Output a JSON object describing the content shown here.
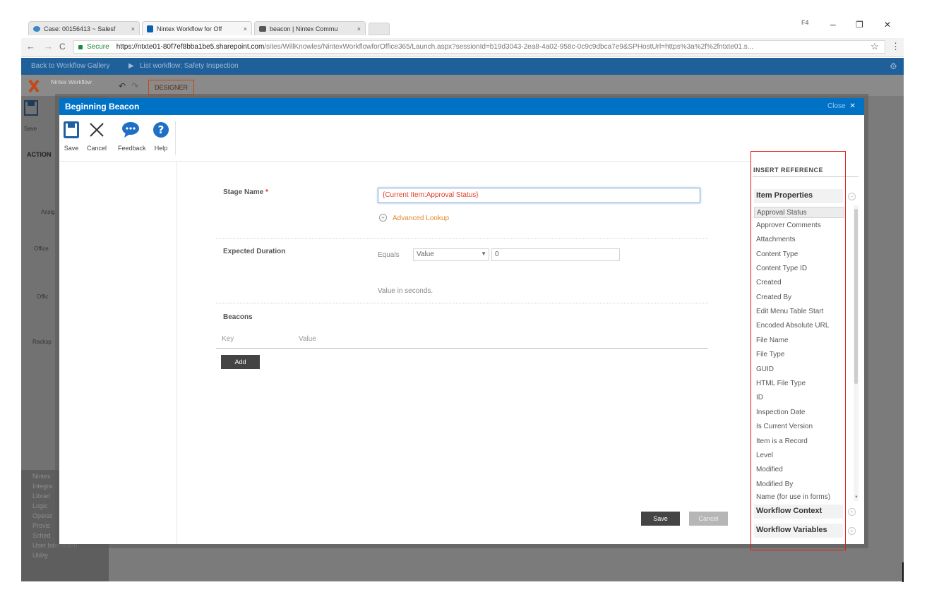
{
  "browser": {
    "tabs": [
      {
        "label": "Case: 00156413 ~ Salesf",
        "icon_color": "#3a86c8"
      },
      {
        "label": "Nintex Workflow for Off",
        "icon_color": "#0b5fb0"
      },
      {
        "label": "beacon | Nintex Commu",
        "icon_color": "#555555"
      }
    ],
    "tab_close": "×",
    "window_controls": {
      "minimize": "–",
      "restore": "❐",
      "close": "✕",
      "badge": "F4"
    },
    "nav": {
      "back": "←",
      "forward": "→",
      "reload": "C"
    },
    "address": {
      "secure_label": "Secure",
      "url_domain": "https://ntxte01-80f7ef8bba1be5.sharepoint.com",
      "url_rest": "/sites/WillKnowles/NintexWorkflowforOffice365/Launch.aspx?sessionId=b19d3043-2ea8-4a02-958c-0c9c9dbca7e9&SPHostUrl=https%3a%2f%2fntxte01.s..."
    },
    "star_icon": "☆",
    "menu_icon": "⋮"
  },
  "background": {
    "breadcrumb_1": "Back to Workflow Gallery",
    "breadcrumb_2": "List workflow: Safety Inspection",
    "logo_text": "Nintex Workflow",
    "designer_tab": "DESIGNER",
    "actions_label": "ACTION",
    "save_label": "Save",
    "left_items": [
      "Assig",
      "Office",
      "Offic",
      "Racksp"
    ],
    "category_items": [
      "Nintex",
      "Integra",
      "Librari",
      "Logic",
      "Operat",
      "Provis",
      "Sched",
      "User Interaction",
      "Utility"
    ]
  },
  "modal": {
    "title": "Beginning Beacon",
    "close_label": "Close",
    "close_icon": "✕",
    "ribbon": [
      {
        "label": "Save",
        "icon": "save-icon"
      },
      {
        "label": "Cancel",
        "icon": "close-icon"
      },
      {
        "label": "Feedback",
        "icon": "speech-bubble-icon"
      },
      {
        "label": "Help",
        "icon": "help-icon"
      }
    ],
    "stage_name": {
      "label": "Stage Name",
      "required_mark": "*",
      "value": "{Current Item:Approval Status}",
      "advanced_lookup": "Advanced Lookup"
    },
    "expected_duration": {
      "label": "Expected Duration",
      "operator": "Equals",
      "type_value": "Value",
      "value": "0",
      "hint": "Value in seconds."
    },
    "beacons": {
      "label": "Beacons",
      "col_key": "Key",
      "col_value": "Value",
      "add_label": "Add"
    },
    "footer": {
      "save_label": "Save",
      "cancel_label": "Cancel"
    },
    "insert_reference": {
      "title": "INSERT REFERENCE",
      "groups": [
        {
          "label": "Item Properties"
        },
        {
          "label": "Workflow Context"
        },
        {
          "label": "Workflow Variables"
        }
      ],
      "items": [
        "Approval Status",
        "Approver Comments",
        "Attachments",
        "Content Type",
        "Content Type ID",
        "Created",
        "Created By",
        "Edit Menu Table Start",
        "Encoded Absolute URL",
        "File Name",
        "File Type",
        "GUID",
        "HTML File Type",
        "ID",
        "Inspection Date",
        "Is Current Version",
        "Item is a Record",
        "Level",
        "Modified",
        "Modified By",
        "Name (for use in forms)"
      ]
    }
  },
  "colors": {
    "modal_header": "#0072c6",
    "highlight_box": "#e01b1b",
    "stage_value": "#e0412a",
    "advanced_lookup": "#e58a2a",
    "sp_suitebar": "#1f5f9a"
  }
}
